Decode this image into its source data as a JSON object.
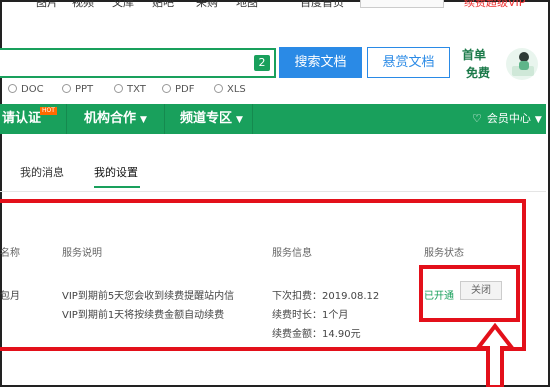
{
  "topnav": {
    "items": [
      "图片",
      "视频",
      "文库",
      "贴吧",
      "采购",
      "地图",
      "百度首页"
    ],
    "vip": "续费超级VIP"
  },
  "search": {
    "badge": "2",
    "search_button": "搜索文档",
    "reward_button": "悬赏文档"
  },
  "promo": {
    "line1": "首单",
    "line2": "免费"
  },
  "filters": [
    "DOC",
    "PPT",
    "TXT",
    "PDF",
    "XLS"
  ],
  "menu": {
    "item1": "请认证",
    "hot": "HOT",
    "item2": "机构合作",
    "item3": "频道专区",
    "member": "会员中心"
  },
  "tabs": {
    "messages": "我的消息",
    "settings": "我的设置"
  },
  "table": {
    "headers": {
      "name": "名称",
      "desc": "服务说明",
      "info": "服务信息",
      "status": "服务状态"
    },
    "row": {
      "name": "包月",
      "desc1": "VIP到期前5天您会收到续费提醒站内信",
      "desc2": "VIP到期前1天将按续费金额自动续费",
      "info1": "下次扣费：2019.08.12",
      "info2": "续费时长：1个月",
      "info3": "续费金额：14.90元",
      "status": "已开通",
      "action": "关闭"
    }
  },
  "colors": {
    "green": "#19a05c",
    "blue": "#2a8ae6",
    "red": "#e3101a"
  }
}
